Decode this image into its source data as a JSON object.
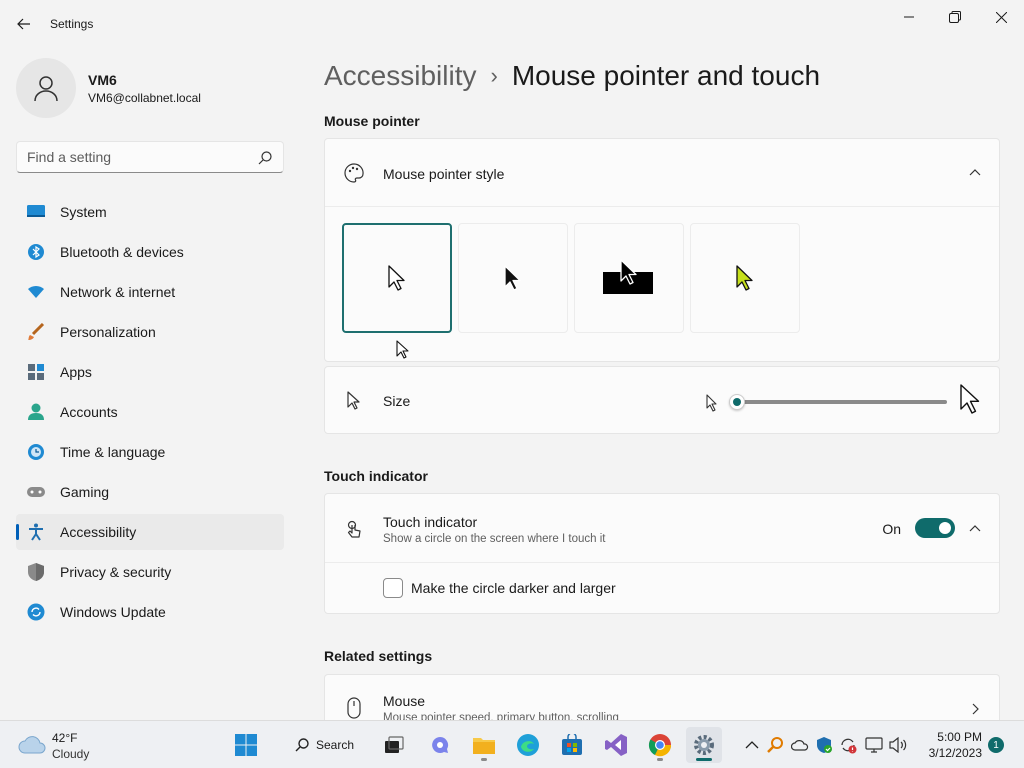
{
  "window": {
    "title": "Settings"
  },
  "profile": {
    "name": "VM6",
    "email": "VM6@collabnet.local"
  },
  "search": {
    "placeholder": "Find a setting"
  },
  "nav": {
    "items": [
      {
        "label": "System",
        "icon": "system-icon"
      },
      {
        "label": "Bluetooth & devices",
        "icon": "bluetooth-icon"
      },
      {
        "label": "Network & internet",
        "icon": "wifi-icon"
      },
      {
        "label": "Personalization",
        "icon": "brush-icon"
      },
      {
        "label": "Apps",
        "icon": "apps-icon"
      },
      {
        "label": "Accounts",
        "icon": "accounts-icon"
      },
      {
        "label": "Time & language",
        "icon": "clock-icon"
      },
      {
        "label": "Gaming",
        "icon": "gamepad-icon"
      },
      {
        "label": "Accessibility",
        "icon": "accessibility-icon",
        "active": true
      },
      {
        "label": "Privacy & security",
        "icon": "shield-icon"
      },
      {
        "label": "Windows Update",
        "icon": "update-icon"
      }
    ]
  },
  "breadcrumb": {
    "parent": "Accessibility",
    "separator": "›",
    "current": "Mouse pointer and touch"
  },
  "mouse_pointer": {
    "section_title": "Mouse pointer",
    "style_label": "Mouse pointer style",
    "styles": [
      {
        "name": "white",
        "selected": true
      },
      {
        "name": "black",
        "selected": false
      },
      {
        "name": "inverted",
        "selected": false
      },
      {
        "name": "custom",
        "selected": false,
        "color": "#c6e01b"
      }
    ],
    "size_label": "Size",
    "size_value": 1,
    "size_min": 1,
    "size_max": 15
  },
  "touch": {
    "section_title": "Touch indicator",
    "label": "Touch indicator",
    "description": "Show a circle on the screen where I touch it",
    "toggle_state": "On",
    "darker_label": "Make the circle darker and larger"
  },
  "related": {
    "section_title": "Related settings",
    "mouse_label": "Mouse",
    "mouse_description": "Mouse pointer speed, primary button, scrolling"
  },
  "taskbar": {
    "weather_temp": "42°F",
    "weather_desc": "Cloudy",
    "search_label": "Search",
    "time": "5:00 PM",
    "date": "3/12/2023",
    "notification_count": "1"
  },
  "colors": {
    "accent": "#0f6b6b",
    "selection_border": "#1e6f6f"
  }
}
